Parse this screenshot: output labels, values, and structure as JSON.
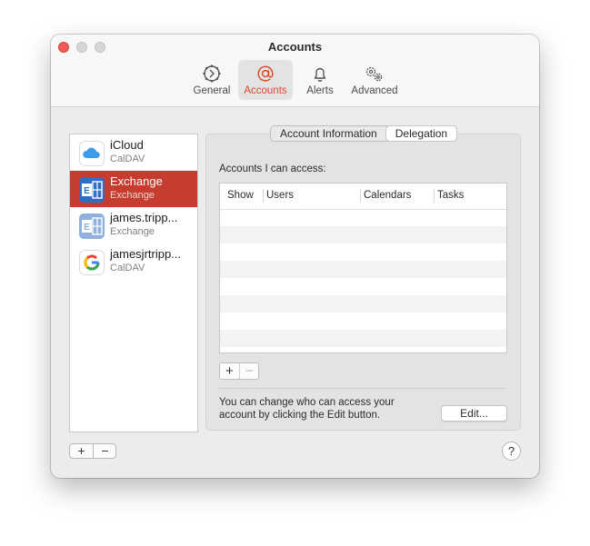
{
  "window": {
    "title": "Accounts"
  },
  "toolbar": {
    "items": [
      {
        "label": "General",
        "icon": "gear-clock-icon",
        "active": false
      },
      {
        "label": "Accounts",
        "icon": "at-sign-icon",
        "active": true
      },
      {
        "label": "Alerts",
        "icon": "bell-icon",
        "active": false
      },
      {
        "label": "Advanced",
        "icon": "gears-icon",
        "active": false
      }
    ]
  },
  "accounts": [
    {
      "name": "iCloud",
      "type": "CalDAV",
      "icon": "icloud-icon",
      "selected": false
    },
    {
      "name": "Exchange",
      "type": "Exchange",
      "icon": "exchange-icon",
      "selected": true
    },
    {
      "name": "james.tripp...",
      "type": "Exchange",
      "icon": "exchange-icon",
      "selected": false
    },
    {
      "name": "jamesjrtripp...",
      "type": "CalDAV",
      "icon": "google-icon",
      "selected": false
    }
  ],
  "sidebar_buttons": {
    "add": "+",
    "remove": "−"
  },
  "tabs": [
    {
      "label": "Account Information",
      "active": false
    },
    {
      "label": "Delegation",
      "active": true
    }
  ],
  "delegation": {
    "access_label": "Accounts I can access:",
    "columns": [
      "Show",
      "Users",
      "Calendars",
      "Tasks"
    ],
    "add": "+",
    "remove": "−",
    "hint": "You can change who can access your account by clicking the Edit button.",
    "edit_label": "Edit..."
  },
  "help_label": "?",
  "colors": {
    "accent": "#c63d2f",
    "active_toolbar_text": "#d94b2b"
  }
}
